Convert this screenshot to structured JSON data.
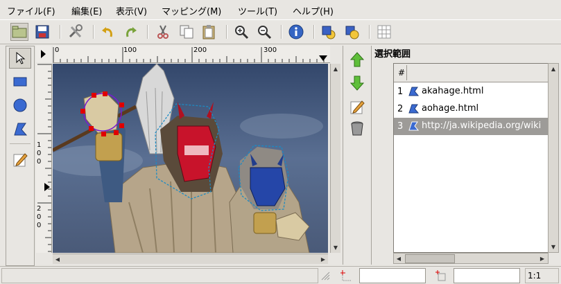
{
  "menu": {
    "file": "ファイル(F)",
    "edit": "編集(E)",
    "view": "表示(V)",
    "mapping": "マッピング(M)",
    "tools": "ツール(T)",
    "help": "ヘルプ(H)"
  },
  "toolbar_icons": [
    "open-icon",
    "save-icon",
    "preferences-icon",
    "undo-icon",
    "redo-icon",
    "cut-icon",
    "copy-icon",
    "paste-icon",
    "zoom-in-icon",
    "zoom-out-icon",
    "info-icon",
    "move-to-front-icon",
    "send-to-back-icon",
    "grid-icon"
  ],
  "left_tools": [
    "pointer-icon",
    "rectangle-icon",
    "circle-icon",
    "polygon-icon",
    "edit-icon"
  ],
  "ruler": {
    "h_labels": [
      "0",
      "100",
      "200",
      "300"
    ],
    "v_labels": [
      "1\n0\n0",
      "2\n0\n0"
    ]
  },
  "selection": {
    "title": "選択範囲",
    "header_num": "#",
    "rows": [
      {
        "num": "1",
        "text": "akahage.html",
        "selected": false
      },
      {
        "num": "2",
        "text": "aohage.html",
        "selected": false
      },
      {
        "num": "3",
        "text": "http://ja.wikipedia.org/wiki",
        "selected": true
      }
    ]
  },
  "status": {
    "zoom": "1:1",
    "coord_field": "",
    "size_field": ""
  },
  "colors": {
    "sky": "#3a4f72",
    "mask_red": "#c8132b",
    "mask_blue": "#2546a8",
    "selected_row": "#9d9b98",
    "handle": "#e00000"
  }
}
